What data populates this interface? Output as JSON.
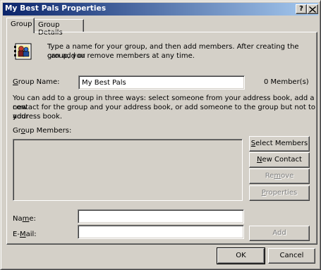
{
  "window": {
    "title": "My Best Pals Properties",
    "help_button": "?",
    "close_button": "X"
  },
  "tabs": [
    {
      "label": "Group"
    },
    {
      "label": "Group Details"
    }
  ],
  "intro_line1": "Type a name for your group, and then add members. After creating the group, you",
  "intro_line2": "can add or remove members at any time.",
  "group_name": {
    "label": "Group Name:",
    "value": "My Best Pals",
    "member_count": "0 Member(s)"
  },
  "ways": {
    "line1": "You can add to a group in three ways: select someone from your address book, add a new",
    "line2": "contact for the group and your address book, or add someone to the group but not to your",
    "line3": "address book."
  },
  "members_label": "Group Members:",
  "side_buttons": {
    "select": "Select Members",
    "new_contact": "New Contact",
    "remove": "Remove",
    "properties": "Properties"
  },
  "name_label": "Name:",
  "email_label": "E-Mail:",
  "add_button": "Add",
  "footer": {
    "ok": "OK",
    "cancel": "Cancel"
  }
}
